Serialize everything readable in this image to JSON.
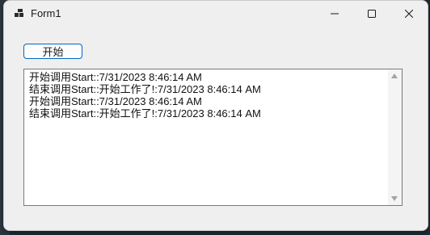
{
  "window": {
    "title": "Form1",
    "icon": "windows-form-icon",
    "controls": {
      "minimize_icon": "minimize-icon",
      "maximize_icon": "maximize-icon",
      "close_icon": "close-icon"
    }
  },
  "form": {
    "start_button_label": "开始",
    "log_lines": [
      "开始调用Start::7/31/2023 8:46:14 AM",
      "结束调用Start::开始工作了!:7/31/2023 8:46:14 AM",
      "开始调用Start::7/31/2023 8:46:14 AM",
      "结束调用Start::开始工作了!:7/31/2023 8:46:14 AM"
    ]
  },
  "colors": {
    "accent": "#0067c0",
    "window_bg": "#efefef",
    "textbox_bg": "#ffffff"
  }
}
